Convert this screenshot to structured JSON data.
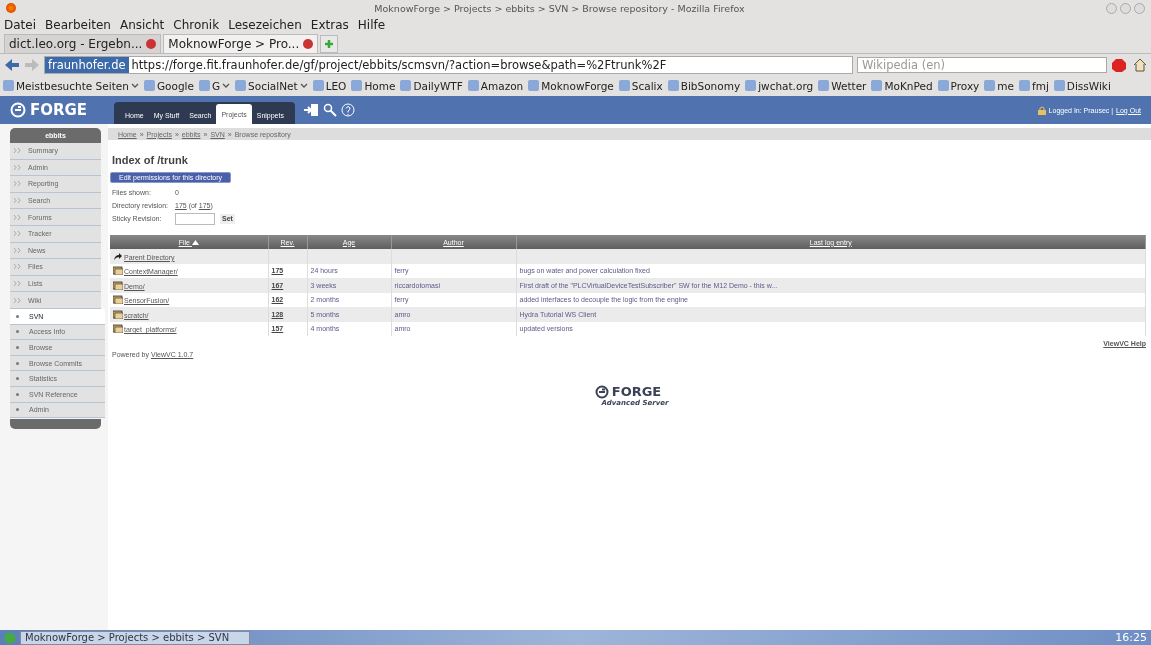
{
  "window": {
    "title": "MoknowForge > Projects > ebbits > SVN > Browse repository - Mozilla Firefox"
  },
  "menu": [
    "Datei",
    "Bearbeiten",
    "Ansicht",
    "Chronik",
    "Lesezeichen",
    "Extras",
    "Hilfe"
  ],
  "tabs": [
    {
      "label": "dict.leo.org - Ergebn...",
      "selected": false
    },
    {
      "label": "MoknowForge > Pro...",
      "selected": true
    }
  ],
  "address": {
    "site": "fraunhofer.de",
    "url": "https://forge.fit.fraunhofer.de/gf/project/ebbits/scmsvn/?action=browse&path=%2Ftrunk%2F"
  },
  "search": {
    "placeholder": "Wikipedia (en)"
  },
  "bookmarks": [
    {
      "label": "Meistbesuchte Seiten",
      "dropdown": true
    },
    {
      "label": "Google",
      "dropdown": false
    },
    {
      "label": "G",
      "dropdown": true
    },
    {
      "label": "SocialNet",
      "dropdown": true
    },
    {
      "label": "LEO",
      "dropdown": false
    },
    {
      "label": "Home",
      "dropdown": false
    },
    {
      "label": "DailyWTF",
      "dropdown": false
    },
    {
      "label": "Amazon",
      "dropdown": false
    },
    {
      "label": "MoknowForge",
      "dropdown": false
    },
    {
      "label": "Scalix",
      "dropdown": false
    },
    {
      "label": "BibSonomy",
      "dropdown": false
    },
    {
      "label": "jwchat.org",
      "dropdown": false
    },
    {
      "label": "Wetter",
      "dropdown": false
    },
    {
      "label": "MoKnPed",
      "dropdown": false
    },
    {
      "label": "Proxy",
      "dropdown": false
    },
    {
      "label": "me",
      "dropdown": false
    },
    {
      "label": "fmj",
      "dropdown": false
    },
    {
      "label": "DissWiki",
      "dropdown": false
    }
  ],
  "forge": {
    "logo": "FORGE",
    "nav": [
      {
        "label": "Home",
        "selected": false
      },
      {
        "label": "My Stuff",
        "selected": false
      },
      {
        "label": "Search",
        "selected": false
      },
      {
        "label": "Projects",
        "selected": true
      },
      {
        "label": "Snippets",
        "selected": false
      }
    ],
    "login": "Logged In: Prausec |",
    "logout": "Log Out"
  },
  "sidebar": {
    "project": "ebbits",
    "items": [
      {
        "label": "Summary",
        "kind": "main",
        "selected": false
      },
      {
        "label": "Admin",
        "kind": "main",
        "selected": false
      },
      {
        "label": "Reporting",
        "kind": "main",
        "selected": false
      },
      {
        "label": "Search",
        "kind": "main",
        "selected": false
      },
      {
        "label": "Forums",
        "kind": "main",
        "selected": false
      },
      {
        "label": "Tracker",
        "kind": "main",
        "selected": false
      },
      {
        "label": "News",
        "kind": "main",
        "selected": false
      },
      {
        "label": "Files",
        "kind": "main",
        "selected": false
      },
      {
        "label": "Lists",
        "kind": "main",
        "selected": false
      },
      {
        "label": "Wiki",
        "kind": "main",
        "selected": false
      },
      {
        "label": "SVN",
        "kind": "sub",
        "selected": true
      },
      {
        "label": "Access Info",
        "kind": "sub",
        "selected": false
      },
      {
        "label": "Browse",
        "kind": "sub",
        "selected": false
      },
      {
        "label": "Browse Commits",
        "kind": "sub",
        "selected": false
      },
      {
        "label": "Statistics",
        "kind": "sub",
        "selected": false
      },
      {
        "label": "SVN Reference",
        "kind": "sub",
        "selected": false
      },
      {
        "label": "Admin",
        "kind": "sub",
        "selected": false
      }
    ]
  },
  "breadcrumb": {
    "separator": "»",
    "links": [
      "Home",
      "Projects",
      "ebbits",
      "SVN"
    ],
    "current": "Browse repository"
  },
  "heading": "Index of /trunk",
  "edit_button": "Edit permissions for this directory",
  "files_shown": {
    "label": "Files shown:",
    "value": "0"
  },
  "directory_revision": {
    "label": "Directory revision:",
    "revision": "175",
    "of": "(of",
    "total": "175",
    "close": ")"
  },
  "sticky_revision": {
    "label": "Sticky Revision:",
    "button": "Set"
  },
  "table": {
    "columns": [
      {
        "label": "File",
        "sorted": true
      },
      {
        "label": "Rev.",
        "sorted": false
      },
      {
        "label": "Age",
        "sorted": false
      },
      {
        "label": "Author",
        "sorted": false
      },
      {
        "label": "Last log entry",
        "sorted": false
      }
    ],
    "rows": [
      {
        "kind": "parent",
        "file": "Parent Directory"
      },
      {
        "kind": "dir",
        "file": "ContextManager/",
        "rev": "175",
        "age": "24 hours",
        "author": "ferry",
        "log": "bugs on water and power calculation fixed"
      },
      {
        "kind": "dir",
        "file": "Demo/",
        "rev": "167",
        "age": "3 weeks",
        "author": "riccardotomasi",
        "log": "First draft of the \"PLCVirtualDeviceTestSubscriber\" SW for the M12 Demo - this w..."
      },
      {
        "kind": "dir",
        "file": "SensorFusion/",
        "rev": "162",
        "age": "2 months",
        "author": "ferry",
        "log": "added interfaces to decouple the logic from the engine"
      },
      {
        "kind": "dir",
        "file": "scratch/",
        "rev": "128",
        "age": "5 months",
        "author": "amro",
        "log": "Hydra Tutorial WS Client"
      },
      {
        "kind": "dir",
        "file": "target_platforms/",
        "rev": "157",
        "age": "4 months",
        "author": "amro",
        "log": "updated versions"
      }
    ]
  },
  "help_link": "ViewVC Help",
  "powered_by": {
    "text": "Powered by",
    "link": "ViewVC 1.0.7"
  },
  "footer_logo": {
    "name": "FORGE",
    "subtitle": "Advanced Server"
  },
  "taskbar": {
    "task": "MoknowForge > Projects > ebbits > SVN",
    "clock": "16:25"
  }
}
